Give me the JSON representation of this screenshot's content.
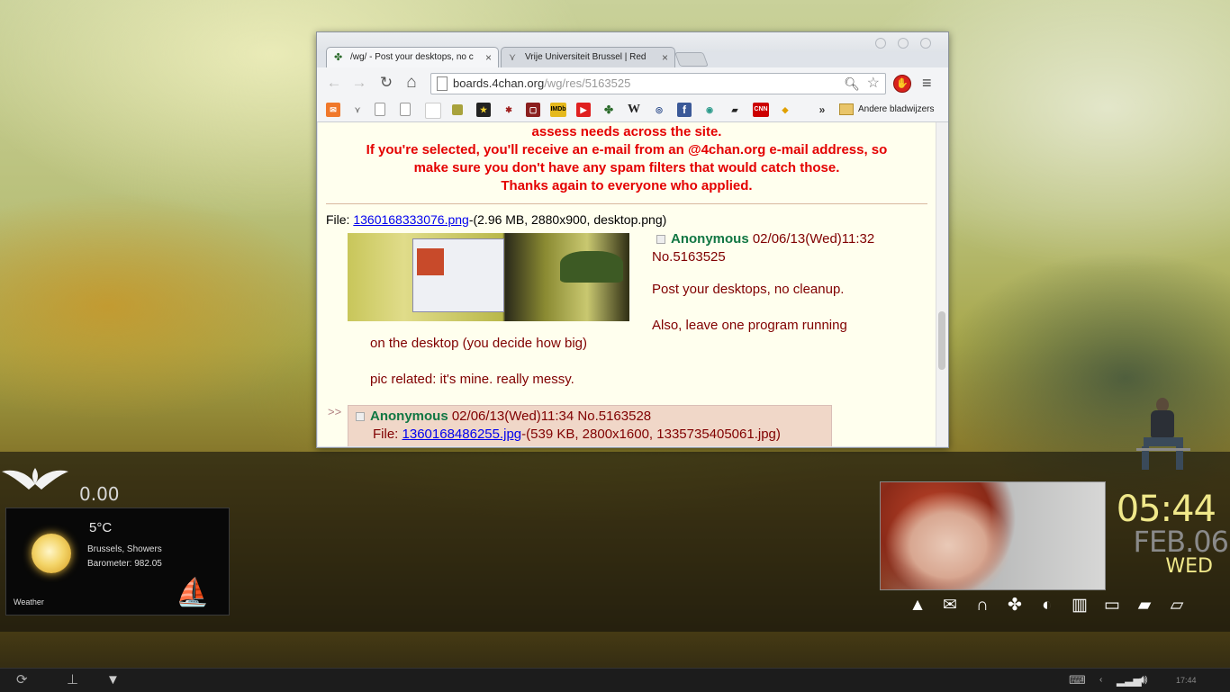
{
  "browser": {
    "tabs": [
      {
        "title": "/wg/ - Post your desktops, no c",
        "close": "×",
        "icon": "clover-icon"
      },
      {
        "title": "Vrije Universiteit Brussel | Red",
        "close": "×",
        "icon": "vub-icon"
      }
    ],
    "nav": {
      "back": "←",
      "forward": "→",
      "reload": "↻",
      "home": "⌂"
    },
    "address": {
      "domain": "boards.4chan.org",
      "path": "/wg/res/5163525"
    },
    "bookmarks_folder": "Andere bladwijzers",
    "bookmark_labels": {
      "imdb": "IMDb",
      "wikipedia": "W",
      "facebook": "f",
      "cnn": "CNN",
      "overflow": "»"
    }
  },
  "page": {
    "announcement": [
      "assess needs across the site.",
      "If you're selected, you'll receive an e-mail from an @4chan.org e-mail address, so",
      "make sure you don't have any spam filters that would catch those.",
      "Thanks again to everyone who applied."
    ],
    "op": {
      "file_prefix": "File: ",
      "file_link": "1360168333076.png",
      "file_info": "-(2.96 MB, 2880x900, desktop.png)",
      "name": "Anonymous",
      "datetime": "02/06/13(Wed)11:32",
      "number": "No.5163525",
      "lines": [
        "Post your desktops, no cleanup.",
        "Also, leave one program running",
        "on the desktop (you decide how big)",
        "pic related: it's mine. really messy."
      ]
    },
    "reply": {
      "arrows": ">>",
      "name": "Anonymous",
      "datetime": "02/06/13(Wed)11:34",
      "number": "No.5163528",
      "file_prefix": "File: ",
      "file_link": "1360168486255.jpg",
      "file_info": "-(539 KB, 2800x1600, 1335735405061.jpg)"
    }
  },
  "desktop": {
    "counter": "0.00",
    "weather": {
      "temp": "5°C",
      "location": "Brussels, Showers",
      "barometer": "Barometer: 982.05",
      "label": "Weather"
    },
    "clock": {
      "time": "05:44",
      "date": "FEB.06",
      "day": "WED"
    },
    "dock_icons": [
      "graduation-cap-icon",
      "mail-icon",
      "headphones-icon",
      "clover-icon",
      "firefox-icon",
      "books-icon",
      "monitor-icon",
      "folder-icon",
      "folder-open-icon"
    ],
    "taskbar": {
      "time": "17:44"
    }
  }
}
